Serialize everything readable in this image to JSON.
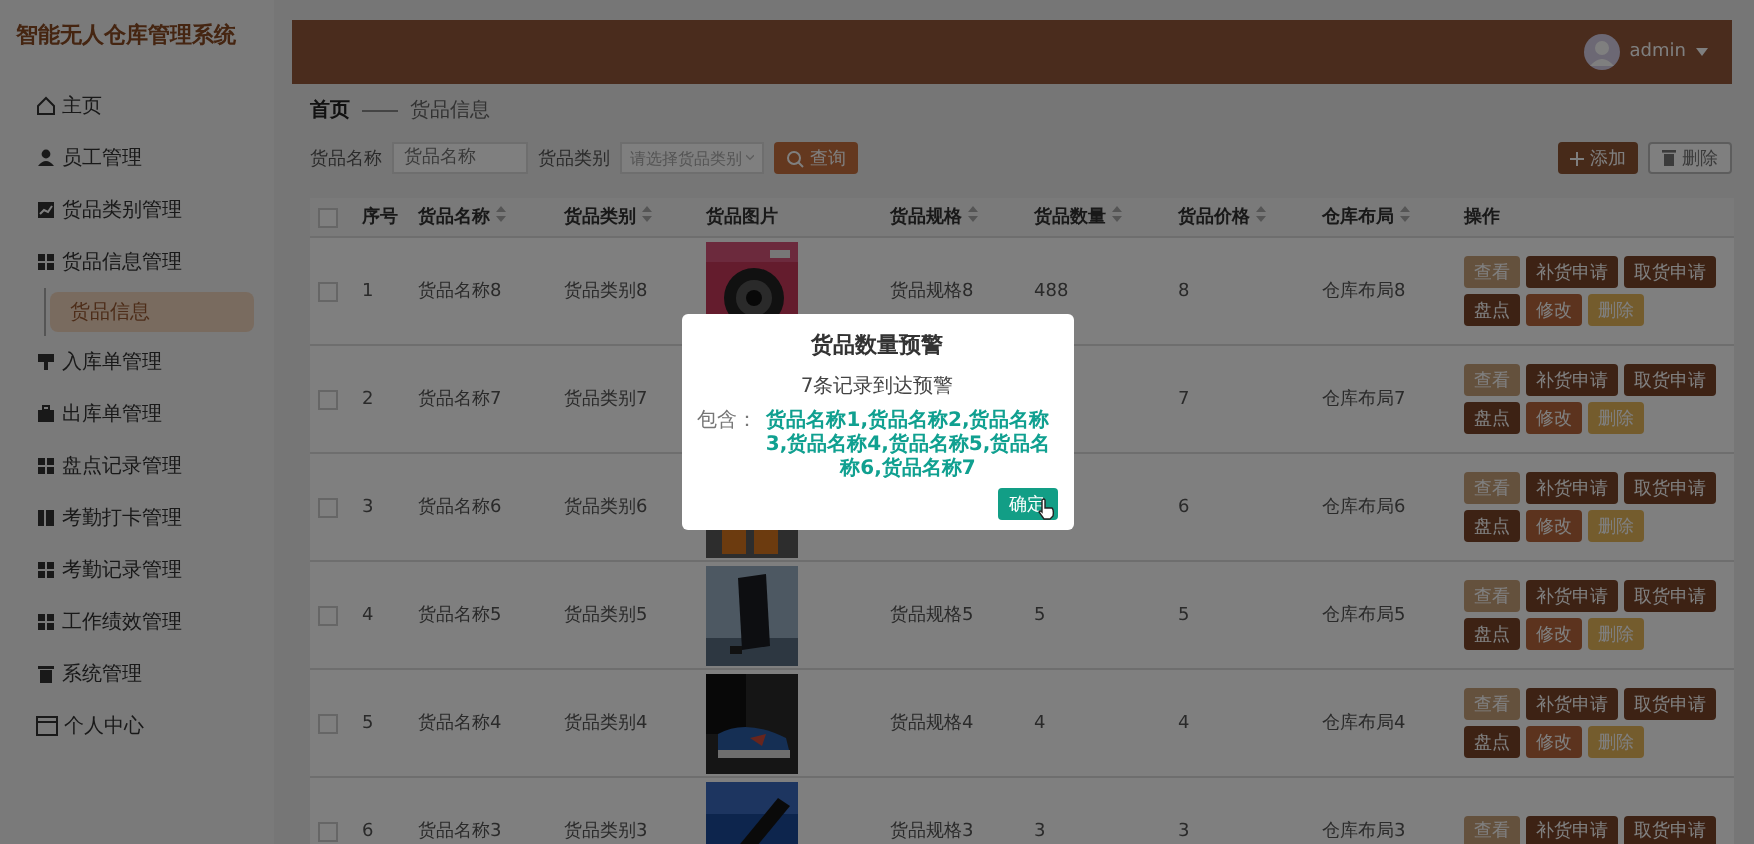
{
  "sidebar": {
    "title": "智能无人仓库管理系统",
    "items": [
      {
        "label": "主页",
        "selected": false
      },
      {
        "label": "员工管理",
        "selected": false
      },
      {
        "label": "货品类别管理",
        "selected": false
      },
      {
        "label": "货品信息管理",
        "selected": false,
        "children": [
          {
            "label": "货品信息",
            "selected": true
          }
        ]
      },
      {
        "label": "入库单管理",
        "selected": false
      },
      {
        "label": "出库单管理",
        "selected": false
      },
      {
        "label": "盘点记录管理",
        "selected": false
      },
      {
        "label": "考勤打卡管理",
        "selected": false
      },
      {
        "label": "考勤记录管理",
        "selected": false
      },
      {
        "label": "工作绩效管理",
        "selected": false
      },
      {
        "label": "系统管理",
        "selected": false
      },
      {
        "label": "个人中心",
        "selected": false
      }
    ]
  },
  "header": {
    "user": "admin"
  },
  "breadcrumb": [
    "首页",
    "货品信息"
  ],
  "search": {
    "name_label": "货品名称",
    "name_placeholder": "货品名称",
    "category_label": "货品类别",
    "category_placeholder": "请选择货品类别",
    "query_button": "查询",
    "add_button": "添加",
    "delete_button": "删除"
  },
  "table": {
    "select_all_checked": false,
    "columns": [
      {
        "label": "序号",
        "kind": "plain"
      },
      {
        "label": "货品名称",
        "kind": "sortable"
      },
      {
        "label": "货品类别",
        "kind": "sortable"
      },
      {
        "label": "货品图片",
        "kind": "plain"
      },
      {
        "label": "货品规格",
        "kind": "sortable"
      },
      {
        "label": "货品数量",
        "kind": "sortable"
      },
      {
        "label": "货品价格",
        "kind": "sortable"
      },
      {
        "label": "仓库布局",
        "kind": "sortable"
      },
      {
        "label": "操作",
        "kind": "plain"
      }
    ],
    "rows": [
      {
        "checked": false,
        "index": "1",
        "name": "货品名称8",
        "category": "货品类别8",
        "spec": "货品规格8",
        "quantity": "488",
        "price": "8",
        "layout": "仓库布局8",
        "actions": [
          {
            "label": "查看",
            "kind": "view"
          },
          {
            "label": "补货申请",
            "kind": "dark"
          },
          {
            "label": "取货申请",
            "kind": "dark"
          },
          {
            "label": "盘点",
            "kind": "dark"
          },
          {
            "label": "修改",
            "kind": "edit"
          },
          {
            "label": "删除",
            "kind": "delete"
          }
        ]
      },
      {
        "checked": false,
        "index": "2",
        "name": "货品名称7",
        "category": "货品类别7",
        "price": "7",
        "layout": "仓库布局7",
        "actions": [
          {
            "label": "查看",
            "kind": "view"
          },
          {
            "label": "补货申请",
            "kind": "dark"
          },
          {
            "label": "取货申请",
            "kind": "dark"
          },
          {
            "label": "盘点",
            "kind": "dark"
          },
          {
            "label": "修改",
            "kind": "edit"
          },
          {
            "label": "删除",
            "kind": "delete"
          }
        ]
      },
      {
        "checked": false,
        "index": "3",
        "name": "货品名称6",
        "category": "货品类别6",
        "price": "6",
        "layout": "仓库布局6",
        "actions": [
          {
            "label": "查看",
            "kind": "view"
          },
          {
            "label": "补货申请",
            "kind": "dark"
          },
          {
            "label": "取货申请",
            "kind": "dark"
          },
          {
            "label": "盘点",
            "kind": "dark"
          },
          {
            "label": "修改",
            "kind": "edit"
          },
          {
            "label": "删除",
            "kind": "delete"
          }
        ]
      },
      {
        "checked": false,
        "index": "4",
        "name": "货品名称5",
        "category": "货品类别5",
        "spec": "货品规格5",
        "quantity": "5",
        "price": "5",
        "layout": "仓库布局5",
        "actions": [
          {
            "label": "查看",
            "kind": "view"
          },
          {
            "label": "补货申请",
            "kind": "dark"
          },
          {
            "label": "取货申请",
            "kind": "dark"
          },
          {
            "label": "盘点",
            "kind": "dark"
          },
          {
            "label": "修改",
            "kind": "edit"
          },
          {
            "label": "删除",
            "kind": "delete"
          }
        ]
      },
      {
        "checked": false,
        "index": "5",
        "name": "货品名称4",
        "category": "货品类别4",
        "spec": "货品规格4",
        "quantity": "4",
        "price": "4",
        "layout": "仓库布局4",
        "actions": [
          {
            "label": "查看",
            "kind": "view"
          },
          {
            "label": "补货申请",
            "kind": "dark"
          },
          {
            "label": "取货申请",
            "kind": "dark"
          },
          {
            "label": "盘点",
            "kind": "dark"
          },
          {
            "label": "修改",
            "kind": "edit"
          },
          {
            "label": "删除",
            "kind": "delete"
          }
        ]
      },
      {
        "checked": false,
        "index": "6",
        "name": "货品名称3",
        "category": "货品类别3",
        "spec": "货品规格3",
        "quantity": "3",
        "price": "3",
        "layout": "仓库布局3",
        "actions": [
          {
            "label": "查看",
            "kind": "view"
          },
          {
            "label": "补货申请",
            "kind": "dark"
          },
          {
            "label": "取货申请",
            "kind": "dark"
          }
        ]
      }
    ]
  },
  "dialog": {
    "title": "货品数量预警",
    "message": "7条记录到达预警",
    "items_label": "包含：",
    "items": "货品名称1,货品名称2,货品名称3,货品名称4,货品名称5,货品名称6,货品名称7",
    "confirm_button": "确定"
  }
}
